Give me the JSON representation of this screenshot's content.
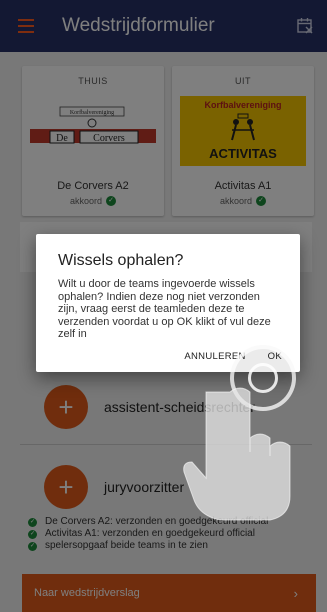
{
  "app_bar": {
    "title": "Wedstrijdformulier",
    "menu_icon": "hamburger-menu-icon",
    "calendar_icon": "calendar-close-icon",
    "background": "#263066",
    "accent": "#ff5a1f"
  },
  "teams": {
    "home": {
      "side_label": "THUIS",
      "logo_small_text": "Korfbalvereniging",
      "logo_text_left": "De",
      "logo_text_right": "Corvers",
      "name": "De Corvers A2",
      "status": "akkoord"
    },
    "away": {
      "side_label": "UIT",
      "logo_top_text": "Korfbalvereniging",
      "logo_bottom_text": "ACTIVITAS",
      "logo_bg": "#f5c400",
      "name": "Activitas A1",
      "status": "akkoord"
    }
  },
  "actions": [
    {
      "label": "assistent-scheidsrechter"
    },
    {
      "label": "juryvoorzitter"
    }
  ],
  "status_list": [
    {
      "text": "De Corvers A2: verzonden en goedgekeurd official"
    },
    {
      "text": "Activitas A1: verzonden en goedgekeurd official"
    },
    {
      "text": "spelersopgaaf beide teams in te zien"
    }
  ],
  "bottom_button": {
    "label": "Naar wedstrijdverslag",
    "chevron": "›",
    "color": "#e05a1a"
  },
  "dialog": {
    "title": "Wissels ophalen?",
    "body": "Wilt u door de teams ingevoerde wissels ophalen? Indien deze nog niet verzonden zijn, vraag eerst de teamleden deze te verzenden voordat u op OK klikt of vul deze zelf in",
    "cancel_label": "ANNULEREN",
    "ok_label": "OK"
  }
}
